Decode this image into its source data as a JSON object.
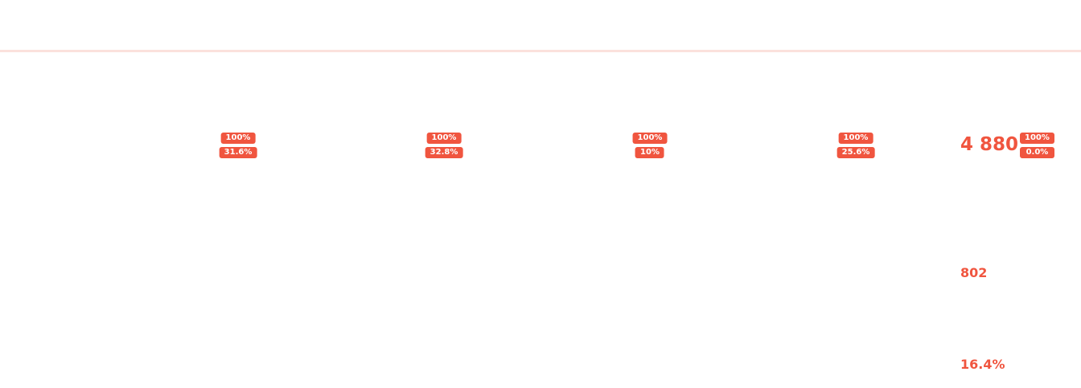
{
  "columns": [
    {
      "total_pct": "100%",
      "share_pct": "31.6%"
    },
    {
      "total_pct": "100%",
      "share_pct": "32.8%"
    },
    {
      "total_pct": "100%",
      "share_pct": "10%"
    },
    {
      "total_pct": "100%",
      "share_pct": "25.6%"
    }
  ],
  "summary": {
    "total": "4 880",
    "total_pct": "100%",
    "change_pct": "0.0%",
    "count": "802",
    "rate": "16.4%"
  },
  "colors": {
    "accent": "#f0553f",
    "rule": "#fbe1dc",
    "background": "#ffffff"
  }
}
